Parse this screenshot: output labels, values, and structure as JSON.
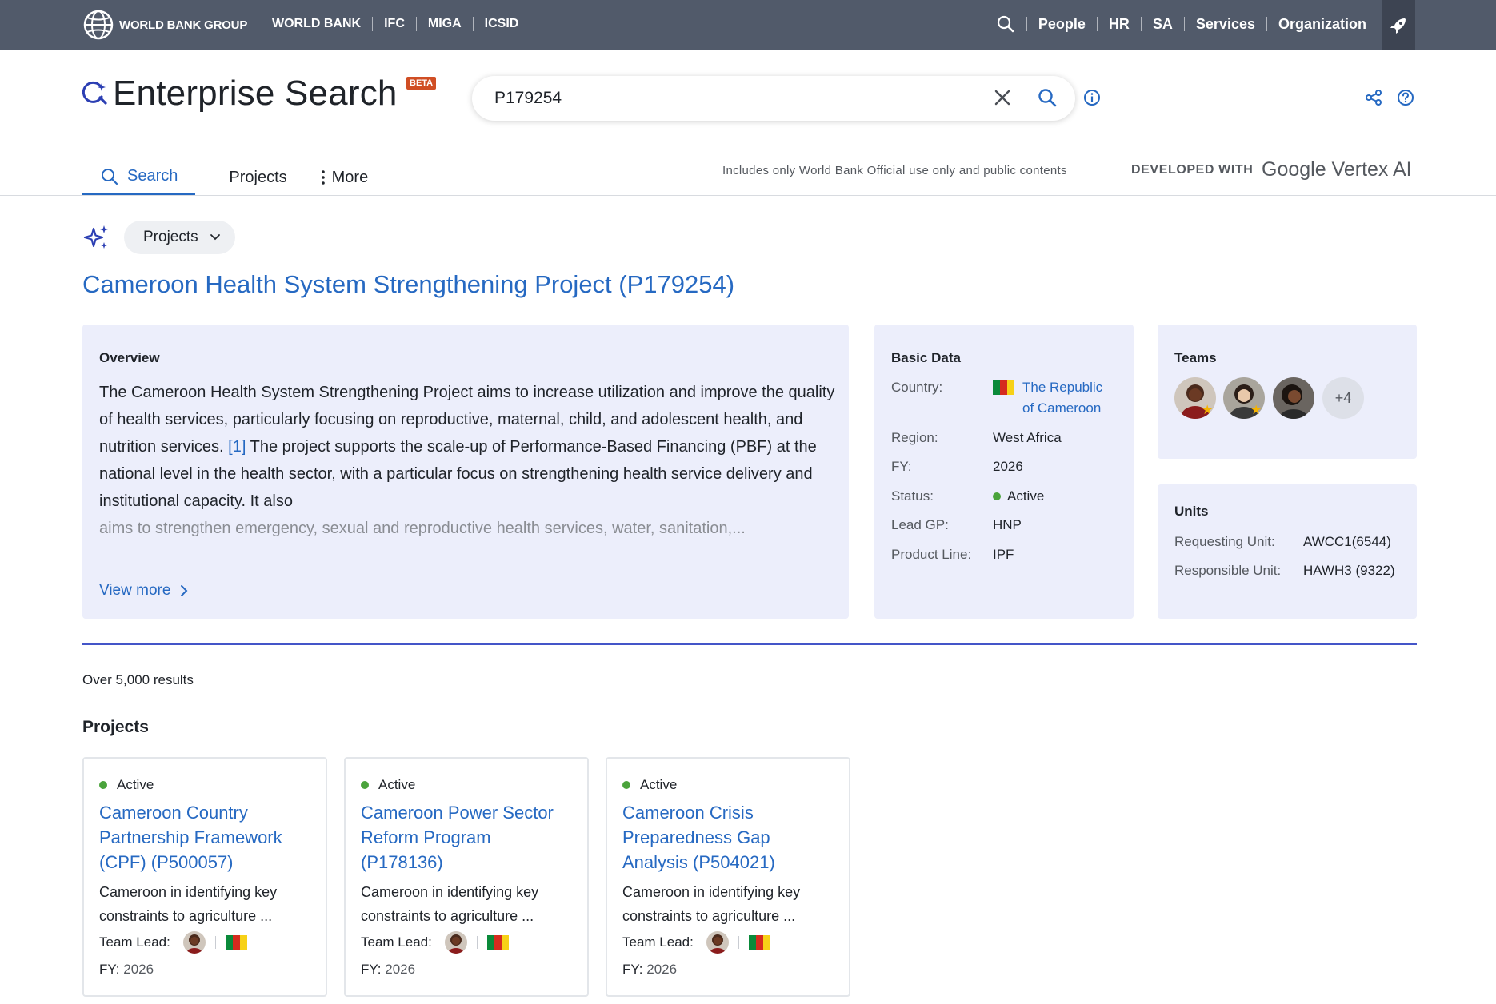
{
  "topbar": {
    "org_name": "WORLD BANK GROUP",
    "left_links": [
      "WORLD BANK",
      "IFC",
      "MIGA",
      "ICSID"
    ],
    "right_links": [
      "People",
      "HR",
      "SA",
      "Services",
      "Organization"
    ]
  },
  "header": {
    "app_title": "Enterprise Search",
    "beta_badge": "BETA",
    "search_value": "P179254"
  },
  "tabs": [
    {
      "label": "Search"
    },
    {
      "label": "Projects"
    },
    {
      "label": "More"
    }
  ],
  "disclaimer": "Includes only World Bank Official use only and public contents",
  "developed_with": "DEVELOPED WITH",
  "developed_with_brand": "Google Vertex AI",
  "scope": {
    "label": "Projects"
  },
  "project": {
    "title": "Cameroon Health System Strengthening Project (P179254)",
    "overview": {
      "heading": "Overview",
      "text_part1": "The Cameroon Health System Strengthening Project aims to increase utilization and improve the quality of health services, particularly focusing on reproductive, maternal, child, and adolescent health, and nutrition services. ",
      "citation": "[1]",
      "text_part2": " The project supports the scale-up of Performance-Based Financing (PBF) at the national level in the health sector, with a particular focus on strengthening health service delivery and institutional capacity. It also",
      "text_fade": "aims to strengthen emergency, sexual and reproductive health services, water, sanitation,...",
      "view_more": "View more"
    },
    "basic_data": {
      "heading": "Basic Data",
      "country_label": "Country:",
      "country_line1": "The Republic",
      "country_line2": "of Cameroon",
      "region_label": "Region:",
      "region": "West Africa",
      "fy_label": "FY:",
      "fy": "2026",
      "status_label": "Status:",
      "status": "Active",
      "lead_gp_label": "Lead GP:",
      "lead_gp": "HNP",
      "product_line_label": "Product Line:",
      "product_line": "IPF"
    },
    "teams": {
      "heading": "Teams",
      "more_count": "+4"
    },
    "units": {
      "heading": "Units",
      "requesting_label": "Requesting Unit:",
      "requesting": "AWCC1(6544)",
      "responsible_label": "Responsible Unit:",
      "responsible": "HAWH3 (9322)"
    }
  },
  "results": {
    "count_text": "Over 5,000 results",
    "section_title": "Projects",
    "cards": [
      {
        "status": "Active",
        "title": "Cameroon Country Partnership Framework (CPF) (P500057)",
        "desc": "Cameroon in identifying key constraints to agriculture ...",
        "lead_label": "Team Lead:",
        "fy_label": "FY:",
        "fy": "2026"
      },
      {
        "status": "Active",
        "title": "Cameroon Power Sector Reform Program (P178136)",
        "desc": "Cameroon in identifying key constraints to agriculture ...",
        "lead_label": "Team Lead:",
        "fy_label": "FY:",
        "fy": "2026"
      },
      {
        "status": "Active",
        "title": "Cameroon Crisis Preparedness Gap Analysis (P504021)",
        "desc": "Cameroon in identifying key constraints to agriculture ...",
        "lead_label": "Team Lead:",
        "fy_label": "FY:",
        "fy": "2026"
      }
    ]
  },
  "colors": {
    "topbar": "#515a6a",
    "accent_blue": "#2669c2",
    "card_bg": "#eceefb",
    "beta": "#d04e24",
    "active_green": "#4aa33b",
    "divider": "#4455c8"
  },
  "icons": [
    "globe-icon",
    "search-icon",
    "rocket-icon",
    "enterprise-search-icon",
    "clear-icon",
    "info-icon",
    "share-icon",
    "help-icon",
    "more-vertical-icon",
    "sparkle-icon",
    "chevron-down-icon",
    "chevron-right-icon",
    "flag-cameroon-icon",
    "star-icon"
  ]
}
